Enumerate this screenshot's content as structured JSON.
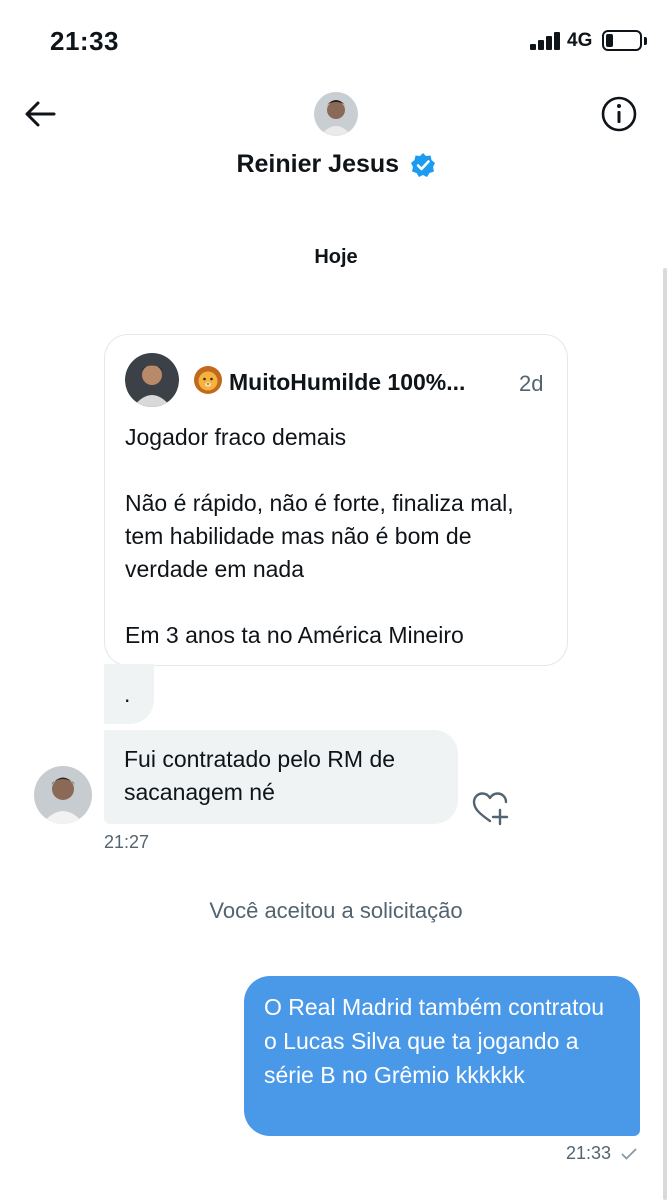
{
  "status_bar": {
    "time": "21:33",
    "network": "4G",
    "battery_level": 0.2
  },
  "header": {
    "name": "Reinier Jesus",
    "verified": true
  },
  "conversation": {
    "date_separator": "Hoje",
    "quoted_tweet": {
      "username": "MuitoHumilde 100%...",
      "emoji": "lion-face",
      "time": "2d",
      "text": "Jogador fraco demais\n\nNão é rápido, não é forte, finaliza mal, tem habilidade mas não é bom de verdade em nada\n\nEm 3 anos ta no América Mineiro"
    },
    "incoming": [
      {
        "text": "."
      },
      {
        "text": "Fui contratado pelo RM de sacanagem né"
      }
    ],
    "incoming_time": "21:27",
    "system_message": "Você aceitou a solicitação",
    "outgoing": {
      "text": "O Real Madrid também contratou o Lucas Silva que ta jogando a série B no Grêmio kkkkkk",
      "time": "21:33"
    }
  },
  "colors": {
    "accent": "#1d9bf0",
    "outgoing_bubble": "#4a99e9",
    "incoming_bubble": "#eff3f4",
    "muted_text": "#536471"
  }
}
